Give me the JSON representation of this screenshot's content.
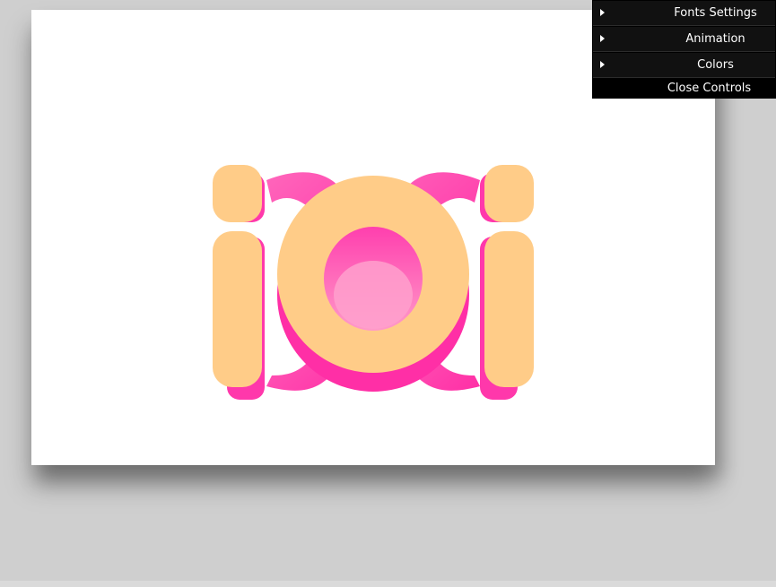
{
  "scene": {
    "text": "iOi",
    "colors": {
      "page_background": "#cfcfcf",
      "canvas_background": "#ffffff",
      "front_face": "#ffcc88",
      "side_face": "#ff33aa",
      "side_face_light": "#ff88cc"
    }
  },
  "gui": {
    "folders": [
      {
        "label": "Fonts Settings",
        "icon": "caret-right-icon"
      },
      {
        "label": "Animation",
        "icon": "caret-right-icon"
      },
      {
        "label": "Colors",
        "icon": "caret-right-icon"
      }
    ],
    "close_label": "Close Controls",
    "colors": {
      "panel_bg": "#000000",
      "folder_bg": "#111111",
      "text": "#ffffff"
    }
  }
}
